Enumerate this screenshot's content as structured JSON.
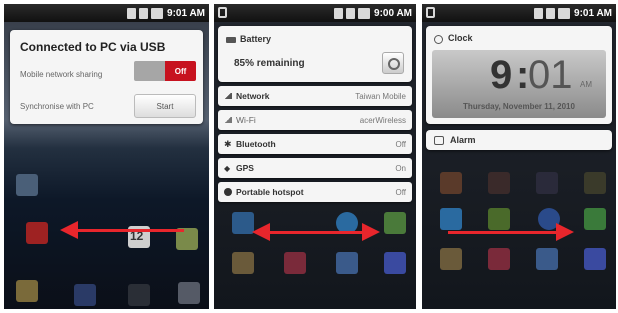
{
  "status_bar": {
    "panel1_time": "9:01 AM",
    "panel2_time": "9:00 AM",
    "panel3_time": "9:01 AM"
  },
  "panel1": {
    "usb_card": {
      "title": "Connected to PC via USB",
      "network_sharing_label": "Mobile network sharing",
      "network_sharing_state": "Off",
      "synchronise_label": "Synchronise with PC",
      "start_button": "Start"
    },
    "dock_calendar_number": "12"
  },
  "panel2": {
    "battery_title": "Battery",
    "battery_remaining": "85% remaining",
    "rows": [
      {
        "name": "Network",
        "value": "Taiwan Mobile"
      },
      {
        "name": "Wi-Fi",
        "value": "acerWireless"
      },
      {
        "name": "Bluetooth",
        "value": "Off"
      },
      {
        "name": "GPS",
        "value": "On"
      },
      {
        "name": "Portable hotspot",
        "value": "Off"
      }
    ]
  },
  "panel3": {
    "clock_title": "Clock",
    "time_hours": "9",
    "time_minutes": "01",
    "time_ampm": "AM",
    "date": "Thursday, November 11, 2010",
    "alarm_title": "Alarm"
  },
  "colors": {
    "arrow": "#e8262c",
    "toggle_on": "#c7121f"
  }
}
